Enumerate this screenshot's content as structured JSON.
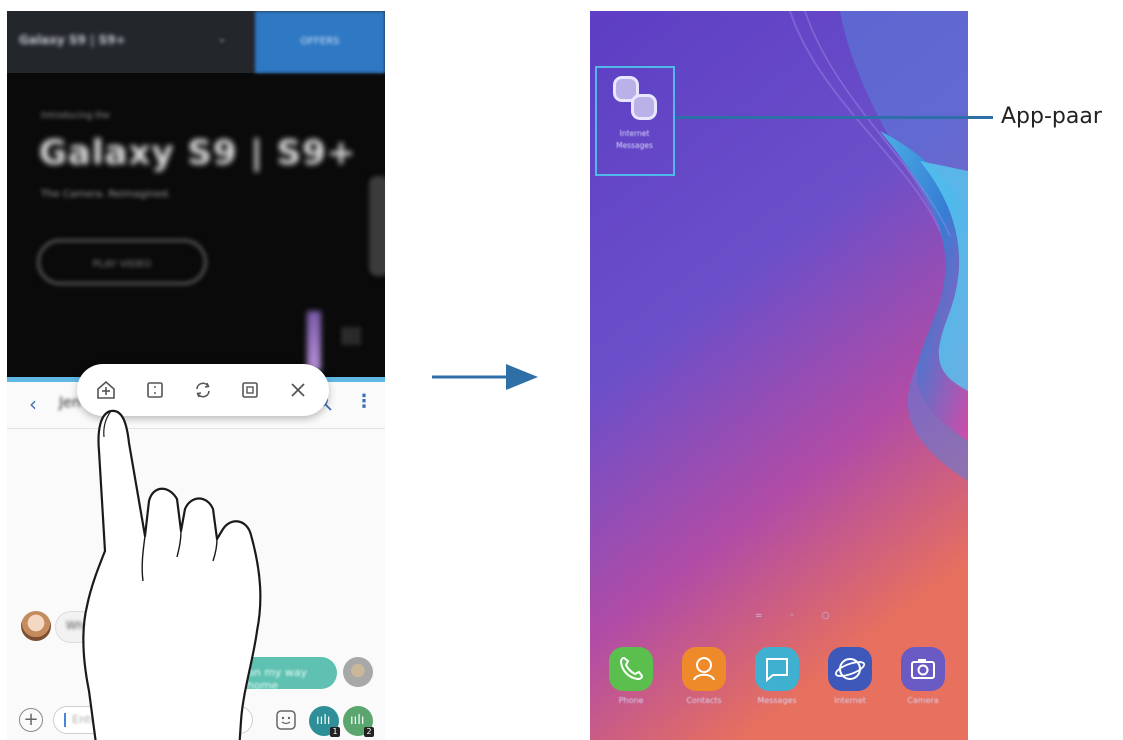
{
  "left_phone": {
    "browser": {
      "model_selector": "Galaxy S9 | S9+",
      "cta": "OFFERS",
      "kicker": "Introducing the",
      "hero": "Galaxy S9 | S9+",
      "subtitle": "The Camera. Reimagined.",
      "play_button": "PLAY VIDEO"
    },
    "chat": {
      "contact_name": "Jen",
      "incoming_message": "Where",
      "outgoing_message": "on my way home",
      "input_placeholder": "Enter message",
      "sim1_badge": "1",
      "sim2_badge": "2"
    },
    "toolbar": {
      "buttons": [
        "add-app-pair",
        "window-view",
        "swap-windows",
        "pop-up-view",
        "close"
      ]
    }
  },
  "right_phone": {
    "app_pair": {
      "apps": [
        "Internet",
        "Messages"
      ],
      "label_line1": "Internet",
      "label_line2": "Messages"
    },
    "dock": [
      {
        "label": "Phone",
        "color": "#5bbf4e",
        "icon": "phone-icon"
      },
      {
        "label": "Contacts",
        "color": "#ef8a2b",
        "icon": "contacts-icon"
      },
      {
        "label": "Messages",
        "color": "#3fb0d0",
        "icon": "messages-icon"
      },
      {
        "label": "Internet",
        "color": "#3d58b9",
        "icon": "internet-icon"
      },
      {
        "label": "Camera",
        "color": "#6a5bc4",
        "icon": "camera-icon"
      }
    ],
    "pager": "= ◦ ○"
  },
  "callout": {
    "label": "App-paar"
  },
  "colors": {
    "accent": "#5fb7e4",
    "callout_line": "#2e6fa8",
    "arrow": "#2e6fa8"
  }
}
